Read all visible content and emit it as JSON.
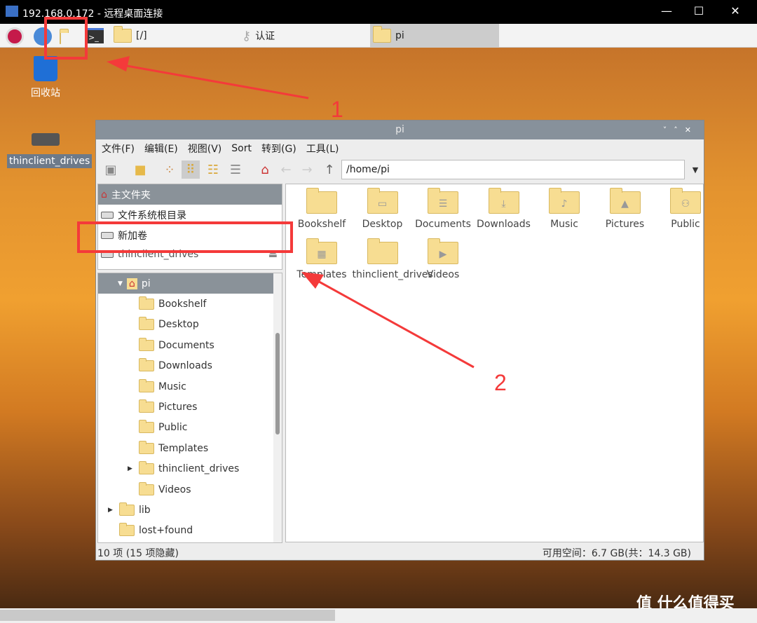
{
  "rdp": {
    "title": "192.168.0.172 - 远程桌面连接",
    "minimize": "—",
    "maximize": "☐",
    "close": "✕"
  },
  "taskbar": {
    "items": [
      {
        "label": "[/]"
      },
      {
        "label": "认证"
      },
      {
        "label": "pi"
      }
    ]
  },
  "desktop": {
    "icons": [
      {
        "label": "回收站"
      },
      {
        "label": "thinclient_drives"
      }
    ]
  },
  "window": {
    "title": "pi",
    "controls": [
      "˅",
      "˄",
      "✕"
    ],
    "menu": [
      "文件(F)",
      "编辑(E)",
      "视图(V)",
      "Sort",
      "转到(G)",
      "工具(L)"
    ],
    "path": "/home/pi",
    "places": [
      {
        "label": "主文件夹",
        "selected": true
      },
      {
        "label": "文件系统根目录"
      },
      {
        "label": "新加卷"
      },
      {
        "label": "thinclient_drives"
      }
    ],
    "tree": [
      {
        "label": "pi",
        "level": 1,
        "expanded": true,
        "selected": true
      },
      {
        "label": "Bookshelf",
        "level": 2
      },
      {
        "label": "Desktop",
        "level": 2
      },
      {
        "label": "Documents",
        "level": 2
      },
      {
        "label": "Downloads",
        "level": 2
      },
      {
        "label": "Music",
        "level": 2
      },
      {
        "label": "Pictures",
        "level": 2
      },
      {
        "label": "Public",
        "level": 2
      },
      {
        "label": "Templates",
        "level": 2
      },
      {
        "label": "thinclient_drives",
        "level": 2,
        "collapsed": true
      },
      {
        "label": "Videos",
        "level": 2
      },
      {
        "label": "lib",
        "level": 0,
        "collapsed": true
      },
      {
        "label": "lost+found",
        "level": 0
      }
    ],
    "files": [
      {
        "label": "Bookshelf",
        "icon": ""
      },
      {
        "label": "Desktop",
        "icon": "▭"
      },
      {
        "label": "Documents",
        "icon": "☰"
      },
      {
        "label": "Downloads",
        "icon": "⤓"
      },
      {
        "label": "Music",
        "icon": "♪"
      },
      {
        "label": "Pictures",
        "icon": "▲"
      },
      {
        "label": "Public",
        "icon": "⚇"
      },
      {
        "label": "Templates",
        "icon": "▦"
      },
      {
        "label": "thinclient_drives",
        "icon": ""
      },
      {
        "label": "Videos",
        "icon": "▶"
      }
    ],
    "status_left": "10 项 (15 项隐藏)",
    "status_right": "可用空间：6.7 GB(共：14.3 GB)"
  },
  "annotations": {
    "one": "1",
    "two": "2"
  },
  "watermark": "值 什么值得买",
  "colors": {
    "annotation": "#f43a3a",
    "titlebar": "#87919b",
    "selection": "#8a9299",
    "folder": "#f7dd92"
  }
}
